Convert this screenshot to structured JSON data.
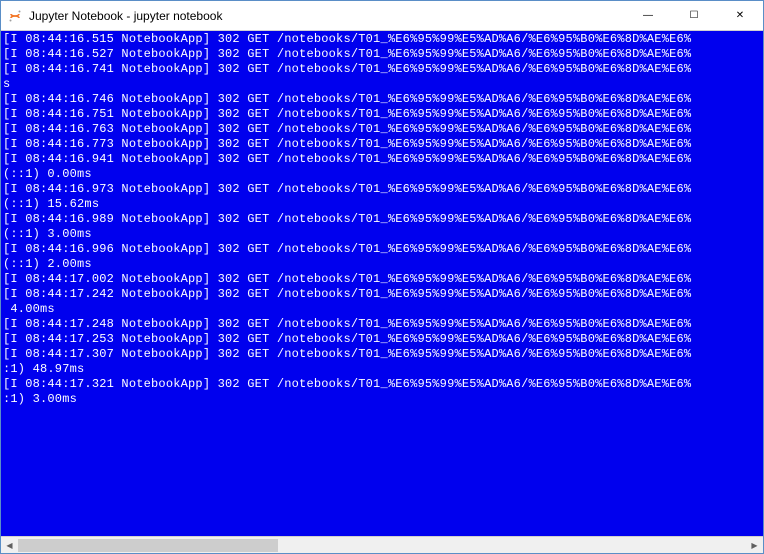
{
  "window": {
    "title": "Jupyter Notebook - jupyter  notebook"
  },
  "controls": {
    "minimize": "—",
    "maximize": "☐",
    "close": "✕"
  },
  "scrollbar": {
    "left": "◀",
    "right": "▶"
  },
  "log": {
    "lines": [
      "[I 08:44:16.515 NotebookApp] 302 GET /notebooks/T01_%E6%95%99%E5%AD%A6/%E6%95%B0%E6%8D%AE%E6%",
      "",
      "[I 08:44:16.527 NotebookApp] 302 GET /notebooks/T01_%E6%95%99%E5%AD%A6/%E6%95%B0%E6%8D%AE%E6%",
      "",
      "[I 08:44:16.741 NotebookApp] 302 GET /notebooks/T01_%E6%95%99%E5%AD%A6/%E6%95%B0%E6%8D%AE%E6%",
      "s",
      "[I 08:44:16.746 NotebookApp] 302 GET /notebooks/T01_%E6%95%99%E5%AD%A6/%E6%95%B0%E6%8D%AE%E6%",
      "",
      "[I 08:44:16.751 NotebookApp] 302 GET /notebooks/T01_%E6%95%99%E5%AD%A6/%E6%95%B0%E6%8D%AE%E6%",
      "",
      "[I 08:44:16.763 NotebookApp] 302 GET /notebooks/T01_%E6%95%99%E5%AD%A6/%E6%95%B0%E6%8D%AE%E6%",
      "",
      "[I 08:44:16.773 NotebookApp] 302 GET /notebooks/T01_%E6%95%99%E5%AD%A6/%E6%95%B0%E6%8D%AE%E6%",
      "",
      "[I 08:44:16.941 NotebookApp] 302 GET /notebooks/T01_%E6%95%99%E5%AD%A6/%E6%95%B0%E6%8D%AE%E6%",
      "(::1) 0.00ms",
      "[I 08:44:16.973 NotebookApp] 302 GET /notebooks/T01_%E6%95%99%E5%AD%A6/%E6%95%B0%E6%8D%AE%E6%",
      "(::1) 15.62ms",
      "[I 08:44:16.989 NotebookApp] 302 GET /notebooks/T01_%E6%95%99%E5%AD%A6/%E6%95%B0%E6%8D%AE%E6%",
      "(::1) 3.00ms",
      "[I 08:44:16.996 NotebookApp] 302 GET /notebooks/T01_%E6%95%99%E5%AD%A6/%E6%95%B0%E6%8D%AE%E6%",
      "(::1) 2.00ms",
      "[I 08:44:17.002 NotebookApp] 302 GET /notebooks/T01_%E6%95%99%E5%AD%A6/%E6%95%B0%E6%8D%AE%E6%",
      "[I 08:44:17.242 NotebookApp] 302 GET /notebooks/T01_%E6%95%99%E5%AD%A6/%E6%95%B0%E6%8D%AE%E6%",
      " 4.00ms",
      "[I 08:44:17.248 NotebookApp] 302 GET /notebooks/T01_%E6%95%99%E5%AD%A6/%E6%95%B0%E6%8D%AE%E6%",
      "[I 08:44:17.253 NotebookApp] 302 GET /notebooks/T01_%E6%95%99%E5%AD%A6/%E6%95%B0%E6%8D%AE%E6%",
      "[I 08:44:17.307 NotebookApp] 302 GET /notebooks/T01_%E6%95%99%E5%AD%A6/%E6%95%B0%E6%8D%AE%E6%",
      ":1) 48.97ms",
      "[I 08:44:17.321 NotebookApp] 302 GET /notebooks/T01_%E6%95%99%E5%AD%A6/%E6%95%B0%E6%8D%AE%E6%",
      ":1) 3.00ms",
      ""
    ]
  }
}
